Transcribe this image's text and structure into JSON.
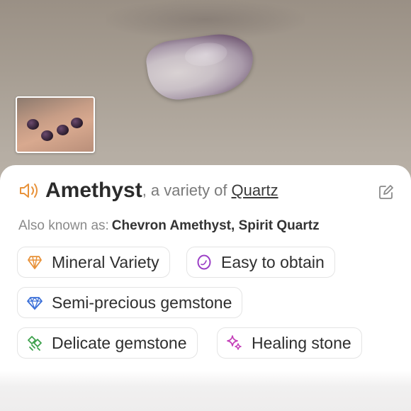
{
  "colors": {
    "speaker_icon": "#e8923a",
    "mineral_icon": "#e8923a",
    "easy_icon": "#9b3fc6",
    "gem_icon": "#3a6fd8",
    "delicate_icon": "#3da14c",
    "healing_icon": "#c43fb8"
  },
  "header": {
    "name": "Amethyst",
    "variety_text": ", a variety of",
    "variety_link": "Quartz"
  },
  "aka": {
    "label": "Also known as:",
    "values": "Chevron Amethyst, Spirit Quartz"
  },
  "tags": [
    {
      "label": "Mineral Variety",
      "icon": "crystal-icon"
    },
    {
      "label": "Easy to obtain",
      "icon": "circle-icon"
    },
    {
      "label": "Semi-precious gemstone",
      "icon": "diamond-icon"
    },
    {
      "label": "Delicate gemstone",
      "icon": "broken-crystal-icon"
    },
    {
      "label": "Healing stone",
      "icon": "sparkle-icon"
    }
  ]
}
